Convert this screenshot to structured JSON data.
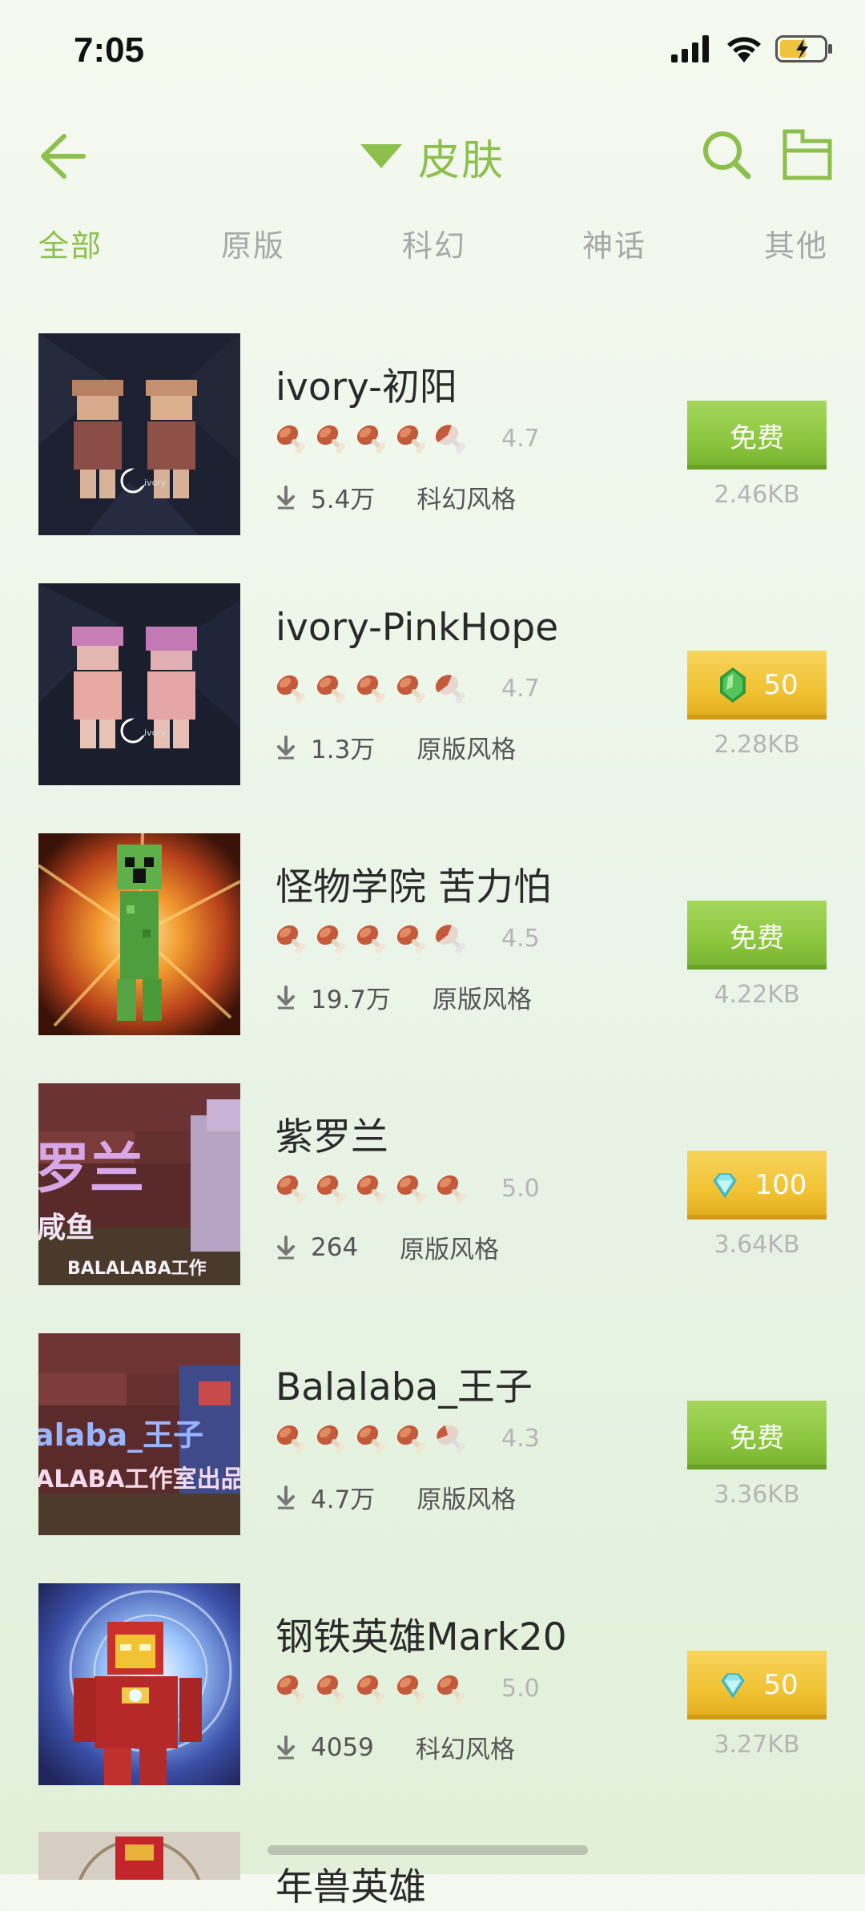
{
  "status_bar": {
    "time": "7:05"
  },
  "nav": {
    "title": "皮肤"
  },
  "tabs": [
    {
      "label": "全部",
      "active": true
    },
    {
      "label": "原版",
      "active": false
    },
    {
      "label": "科幻",
      "active": false
    },
    {
      "label": "神话",
      "active": false
    },
    {
      "label": "其他",
      "active": false
    }
  ],
  "items": [
    {
      "title": "ivory-初阳",
      "rating": "4.7",
      "downloads": "5.4万",
      "style": "科幻风格",
      "price": "免费",
      "price_type": "free",
      "size": "2.46KB"
    },
    {
      "title": "ivory-PinkHope",
      "rating": "4.7",
      "downloads": "1.3万",
      "style": "原版风格",
      "price": "50",
      "price_type": "emerald",
      "size": "2.28KB"
    },
    {
      "title": "怪物学院 苦力怕",
      "rating": "4.5",
      "downloads": "19.7万",
      "style": "原版风格",
      "price": "免费",
      "price_type": "free",
      "size": "4.22KB"
    },
    {
      "title": "紫罗兰",
      "rating": "5.0",
      "downloads": "264",
      "style": "原版风格",
      "price": "100",
      "price_type": "diamond",
      "size": "3.64KB"
    },
    {
      "title": "Balalaba_王子",
      "rating": "4.3",
      "downloads": "4.7万",
      "style": "原版风格",
      "price": "免费",
      "price_type": "free",
      "size": "3.36KB"
    },
    {
      "title": "钢铁英雄Mark20",
      "rating": "5.0",
      "downloads": "4059",
      "style": "科幻风格",
      "price": "50",
      "price_type": "diamond",
      "size": "3.27KB"
    }
  ],
  "partial_item": {
    "title": "年兽英雄"
  },
  "colors": {
    "accent": "#8cbf4c",
    "free_button": "#8cc63f",
    "paid_button": "#f1c232"
  }
}
